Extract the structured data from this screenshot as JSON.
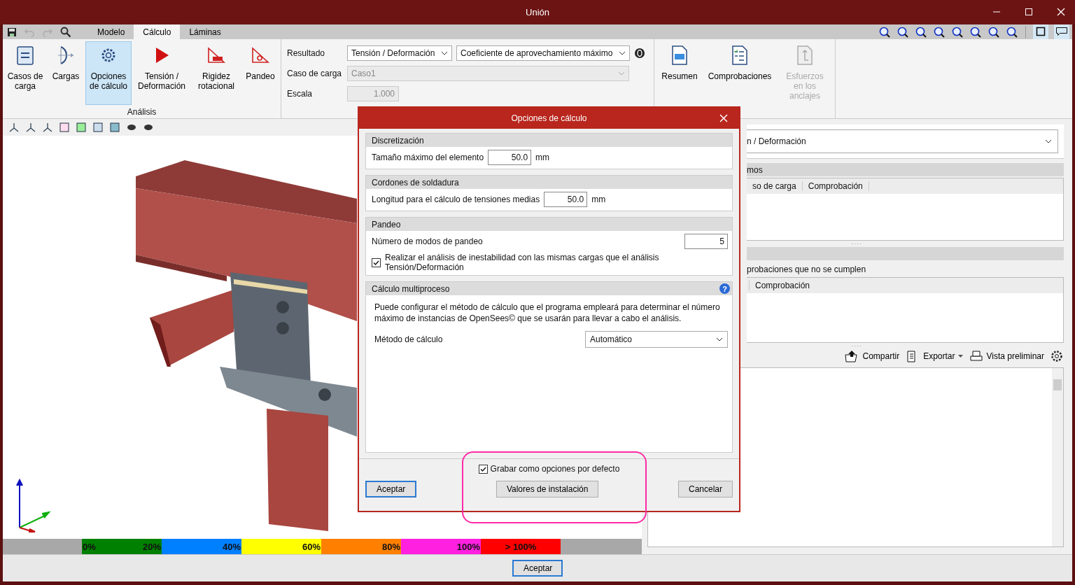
{
  "window": {
    "title": "Unión"
  },
  "tabs": [
    {
      "label": "Modelo",
      "selected": false
    },
    {
      "label": "Cálculo",
      "selected": true
    },
    {
      "label": "Láminas",
      "selected": false
    }
  ],
  "view_toggles": [
    {
      "selected": true
    },
    {
      "selected": true
    }
  ],
  "ribbon": {
    "analysis_group": {
      "label": "Análisis",
      "buttons": [
        {
          "label": "Casos de carga",
          "selected": false
        },
        {
          "label": "Cargas",
          "selected": false
        },
        {
          "label": "Opciones de cálculo",
          "selected": true
        },
        {
          "label": "Tensión / Deformación",
          "selected": false
        },
        {
          "label": "Rigidez rotacional",
          "selected": false
        },
        {
          "label": "Pandeo",
          "selected": false
        }
      ]
    },
    "fields": {
      "result_label": "Resultado",
      "result_value": "Tensión / Deformación",
      "result_detail": "Coeficiente de aprovechamiento máximo",
      "load_case_label": "Caso de carga",
      "load_case_value": "Caso1",
      "scale_label": "Escala",
      "scale_value": "1.000"
    },
    "report_buttons": [
      {
        "label": "Resumen",
        "disabled": false
      },
      {
        "label": "Comprobaciones",
        "disabled": false
      },
      {
        "label": "Esfuerzos en los anclajes",
        "disabled": true
      }
    ]
  },
  "legend": [
    {
      "color": "#008000",
      "labels": [
        "0%",
        "20%"
      ]
    },
    {
      "color": "#0080ff",
      "labels": [
        "40%"
      ]
    },
    {
      "color": "#ffff00",
      "labels": [
        "60%"
      ]
    },
    {
      "color": "#ff8000",
      "labels": [
        "80%"
      ]
    },
    {
      "color": "#ff20e0",
      "labels": [
        "100%"
      ]
    },
    {
      "color": "#ff0000",
      "labels": [
        "> 100%"
      ]
    }
  ],
  "right_panel": {
    "result_select": "n / Deformación",
    "section_1_title": "mos",
    "table_1_columns": [
      "so de carga",
      "Comprobación"
    ],
    "failed_note": "probaciones que no se cumplen",
    "table_2_columns": [
      "Comprobación"
    ],
    "actions": [
      "Compartir",
      "Exportar",
      "Vista preliminar"
    ]
  },
  "dialog": {
    "title": "Opciones de cálculo",
    "sections": [
      {
        "title": "Discretización",
        "rows": [
          {
            "kind": "number",
            "label": "Tamaño máximo del elemento",
            "value": "50.0",
            "unit": "mm"
          }
        ]
      },
      {
        "title": "Cordones de soldadura",
        "rows": [
          {
            "kind": "number",
            "label": "Longitud para el cálculo de tensiones medias",
            "value": "50.0",
            "unit": "mm"
          }
        ]
      },
      {
        "title": "Pandeo",
        "rows": [
          {
            "kind": "number_wide",
            "label": "Número de modos de pandeo",
            "value": "5"
          },
          {
            "kind": "checkbox",
            "label": "Realizar el análisis de inestabilidad con las mismas cargas que el análisis Tensión/Deformación",
            "checked": true
          }
        ]
      },
      {
        "title": "Cálculo multiproceso",
        "help": "?",
        "rows": [
          {
            "kind": "text",
            "text": "Puede configurar el método de cálculo que el programa empleará para determinar el número máximo de instancias de OpenSees© que se usarán para llevar a cabo el análisis."
          },
          {
            "kind": "select",
            "label": "Método de cálculo",
            "value": "Automático"
          }
        ]
      }
    ],
    "save_default": {
      "label": "Grabar como opciones por defecto",
      "checked": true
    },
    "buttons": [
      "Aceptar",
      "Valores de instalación",
      "Cancelar"
    ]
  },
  "footer_button": "Aceptar"
}
